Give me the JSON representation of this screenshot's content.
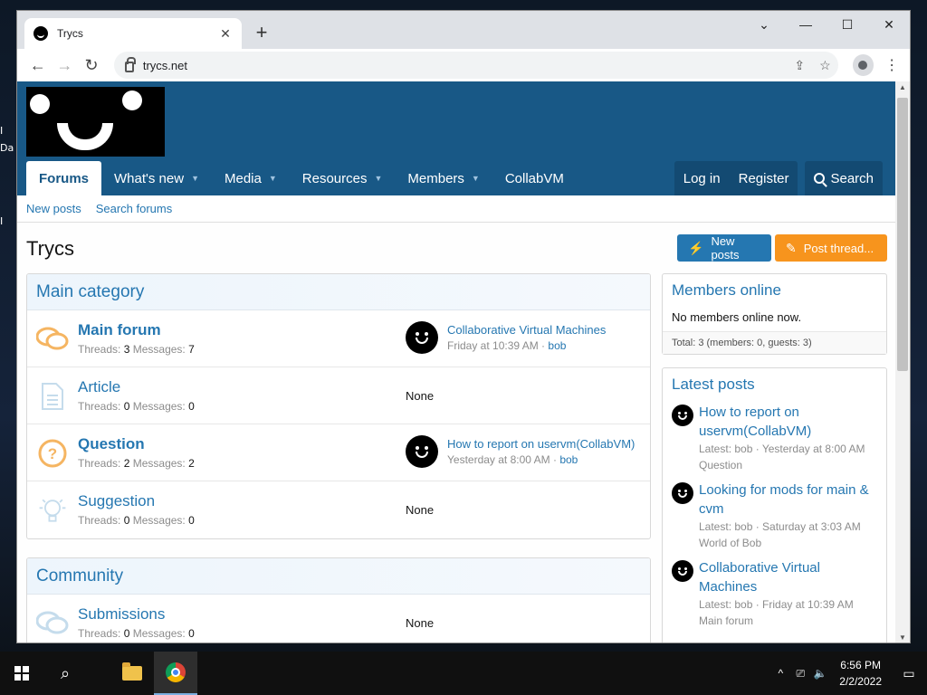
{
  "browser": {
    "tab_title": "Trycs",
    "url": "trycs.net",
    "new_tab": "+",
    "tab_close": "✕"
  },
  "site": {
    "nav": [
      {
        "label": "Forums",
        "active": true
      },
      {
        "label": "What's new",
        "caret": true
      },
      {
        "label": "Media",
        "caret": true
      },
      {
        "label": "Resources",
        "caret": true
      },
      {
        "label": "Members",
        "caret": true
      },
      {
        "label": "CollabVM"
      }
    ],
    "login": "Log in",
    "register": "Register",
    "search": "Search",
    "subnav": [
      "New posts",
      "Search forums"
    ],
    "page_title": "Trycs",
    "btn_new_posts": "New posts",
    "btn_post_thread": "Post thread..."
  },
  "categories": [
    {
      "title": "Main category",
      "nodes": [
        {
          "title": "Main forum",
          "bold": true,
          "threads_label": "Threads:",
          "threads": "3",
          "messages_label": "Messages:",
          "messages": "7",
          "last_title": "Collaborative Virtual Machines",
          "last_time": "Friday at 10:39 AM",
          "last_user": "bob"
        },
        {
          "title": "Article",
          "bold": false,
          "threads_label": "Threads:",
          "threads": "0",
          "messages_label": "Messages:",
          "messages": "0",
          "none": "None"
        },
        {
          "title": "Question",
          "bold": true,
          "threads_label": "Threads:",
          "threads": "2",
          "messages_label": "Messages:",
          "messages": "2",
          "last_title": "How to report on uservm(CollabVM)",
          "last_time": "Yesterday at 8:00 AM",
          "last_user": "bob"
        },
        {
          "title": "Suggestion",
          "bold": false,
          "threads_label": "Threads:",
          "threads": "0",
          "messages_label": "Messages:",
          "messages": "0",
          "none": "None"
        }
      ]
    },
    {
      "title": "Community",
      "nodes": [
        {
          "title": "Submissions",
          "bold": false,
          "threads_label": "Threads:",
          "threads": "0",
          "messages_label": "Messages:",
          "messages": "0",
          "none": "None"
        }
      ]
    }
  ],
  "sidebar": {
    "members_online": {
      "title": "Members online",
      "body": "No members online now.",
      "footer": "Total: 3 (members: 0, guests: 3)"
    },
    "latest_posts": {
      "title": "Latest posts",
      "items": [
        {
          "title": "How to report on uservm(CollabVM)",
          "meta": "Latest: bob · Yesterday at 8:00 AM",
          "forum": "Question"
        },
        {
          "title": "Looking for mods for main & cvm",
          "meta": "Latest: bob · Saturday at 3:03 AM",
          "forum": "World of Bob"
        },
        {
          "title": "Collaborative Virtual Machines",
          "meta": "Latest: bob · Friday at 10:39 AM",
          "forum": "Main forum"
        }
      ]
    }
  },
  "taskbar": {
    "time": "6:56 PM",
    "date": "2/2/2022"
  },
  "desktop": {
    "frag1": "I",
    "frag2": "Da",
    "frag3": "I"
  }
}
